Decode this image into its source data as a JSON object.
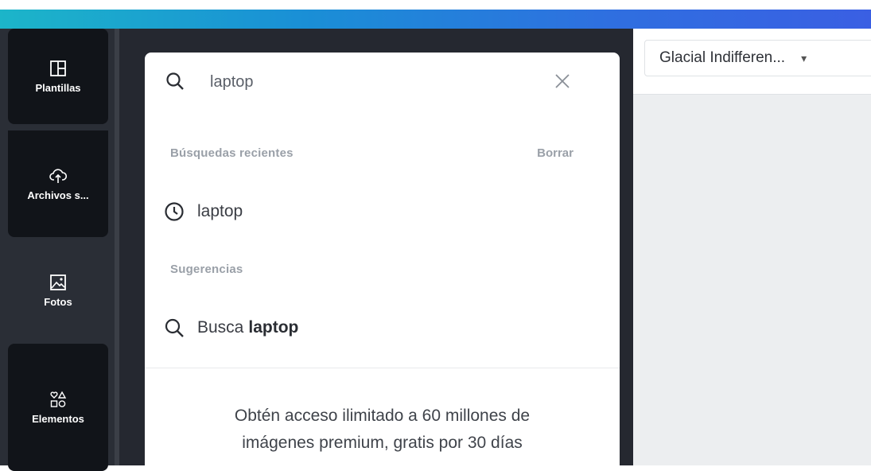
{
  "sidebar": {
    "items": [
      {
        "label": "Plantillas",
        "icon": "templates-icon"
      },
      {
        "label": "Archivos s...",
        "icon": "upload-cloud-icon"
      },
      {
        "label": "Fotos",
        "icon": "photo-icon"
      },
      {
        "label": "Elementos",
        "icon": "shapes-icon"
      }
    ]
  },
  "search": {
    "value": "laptop",
    "placeholder": ""
  },
  "recent": {
    "heading": "Búsquedas recientes",
    "clear_label": "Borrar",
    "items": [
      {
        "label": "laptop",
        "icon": "clock-icon"
      }
    ]
  },
  "suggestions": {
    "heading": "Sugerencias",
    "prefix": "Busca",
    "term": "laptop"
  },
  "promo": {
    "line1": "Obtén acceso ilimitado a 60 millones de",
    "line2": "imágenes premium, gratis por 30 días"
  },
  "toolbar": {
    "font_name": "Glacial Indifferen..."
  },
  "colors": {
    "sidebar_bg": "#2a2e36",
    "panel_bg": "#252830",
    "accent_gradient_start": "#1cb5c9",
    "accent_gradient_end": "#3a5fe3"
  }
}
